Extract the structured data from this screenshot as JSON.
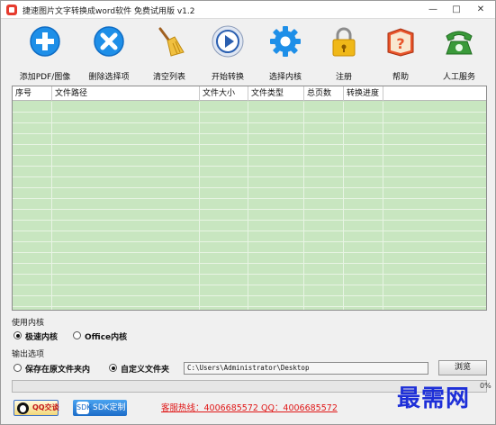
{
  "window": {
    "title": "捷速图片文字转换成word软件 免费试用版 v1.2",
    "controls": {
      "minimize": "—",
      "maximize": "□",
      "close": "✕"
    }
  },
  "toolbar": {
    "items": [
      {
        "label": "添加PDF/图像",
        "icon": "add-icon",
        "color": "#1e8fe8"
      },
      {
        "label": "删除选择项",
        "icon": "delete-icon",
        "color": "#1e8fe8"
      },
      {
        "label": "清空列表",
        "icon": "broom-icon",
        "color": "#e8b030"
      },
      {
        "label": "开始转换",
        "icon": "play-icon",
        "color": "#2a5fb0"
      },
      {
        "label": "选择内核",
        "icon": "gear-icon",
        "color": "#1e8fe8"
      },
      {
        "label": "注册",
        "icon": "lock-icon",
        "color": "#f0b818"
      },
      {
        "label": "帮助",
        "icon": "help-book-icon",
        "color": "#e8542a"
      },
      {
        "label": "人工服务",
        "icon": "phone-icon",
        "color": "#3a9a3a"
      }
    ]
  },
  "file_table": {
    "columns": [
      "序号",
      "文件路径",
      "文件大小",
      "文件类型",
      "总页数",
      "转换进度"
    ],
    "rows": [],
    "row_color": "#c8e6c0"
  },
  "engine": {
    "label": "使用内核",
    "options": [
      {
        "label": "极速内核",
        "selected": true
      },
      {
        "label": "Office内核",
        "selected": false
      }
    ]
  },
  "output": {
    "label": "输出选项",
    "options": [
      {
        "label": "保存在原文件夹内",
        "selected": false
      },
      {
        "label": "自定义文件夹",
        "selected": true
      }
    ],
    "path": "C:\\Users\\Administrator\\Desktop",
    "browse_label": "浏览"
  },
  "progress": {
    "value": 0,
    "percent_text": "0%"
  },
  "footer": {
    "qq_label": "QQ交谈",
    "sdk_label": "SDK定制",
    "sdk_icon_text": "SDK",
    "hotline": "客服热线：4006685572 QQ：4006685572"
  },
  "watermark": "最需网"
}
